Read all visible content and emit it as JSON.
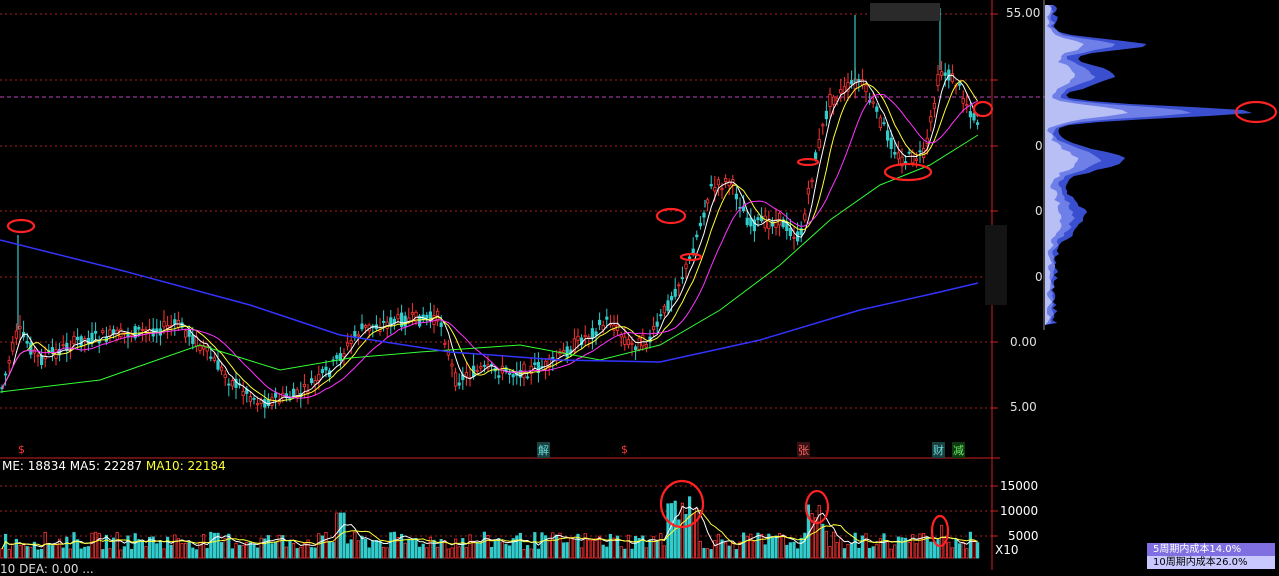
{
  "main_chart": {
    "price_labels": [
      "55.00",
      "0",
      "0",
      "0",
      "0.00",
      "5.00"
    ],
    "event_markers": [
      {
        "label": "$",
        "color": "#ff3333"
      },
      {
        "label": "解",
        "color": "#33cccc"
      },
      {
        "label": "$",
        "color": "#ff3333"
      },
      {
        "label": "张",
        "color": "#ff3333"
      },
      {
        "label": "财",
        "color": "#33cccc"
      },
      {
        "label": "减",
        "color": "#33cc33"
      }
    ]
  },
  "volume_panel": {
    "legend_name": "ME: 18834",
    "legend_ma5": "MA5: 22287",
    "legend_ma10": "MA10: 22184",
    "tick_labels": [
      "15000",
      "10000",
      "5000"
    ],
    "unit": "X10",
    "bottom_cut_text": "10 DEA: 0.00 ..."
  },
  "cost_panel": {
    "row1": "5周期内成本14.0%",
    "row2": "10周期内成本26.0%"
  },
  "colors": {
    "up": "#ff3333",
    "down": "#33cccc",
    "ma5": "#ffffff",
    "ma10": "#ffff33",
    "ma20": "#ff33ff",
    "ma60": "#33ff33",
    "ma250": "#3333ff",
    "grid": "#aa2020",
    "annotation": "#ff2222"
  }
}
